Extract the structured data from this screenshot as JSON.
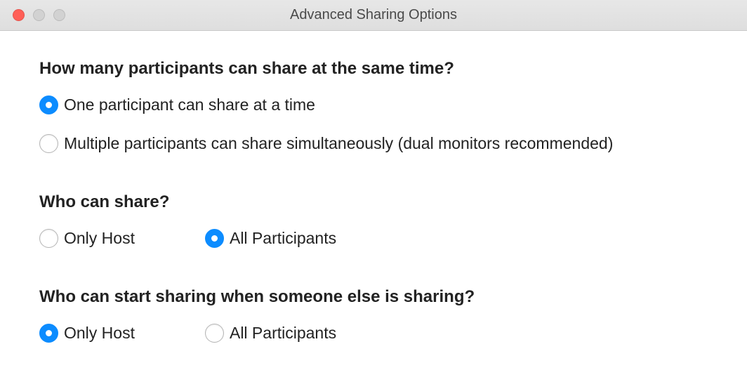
{
  "window": {
    "title": "Advanced Sharing Options"
  },
  "sections": {
    "howMany": {
      "question": "How many participants can share at the same time?",
      "options": {
        "one": {
          "label": "One participant can share at a time",
          "selected": true
        },
        "multi": {
          "label": "Multiple participants can share simultaneously (dual monitors recommended)",
          "selected": false
        }
      }
    },
    "whoCanShare": {
      "question": "Who can share?",
      "options": {
        "host": {
          "label": "Only Host",
          "selected": false
        },
        "all": {
          "label": "All Participants",
          "selected": true
        }
      }
    },
    "whoCanStart": {
      "question": "Who can start sharing when someone else is sharing?",
      "options": {
        "host": {
          "label": "Only Host",
          "selected": true
        },
        "all": {
          "label": "All Participants",
          "selected": false
        }
      }
    }
  }
}
